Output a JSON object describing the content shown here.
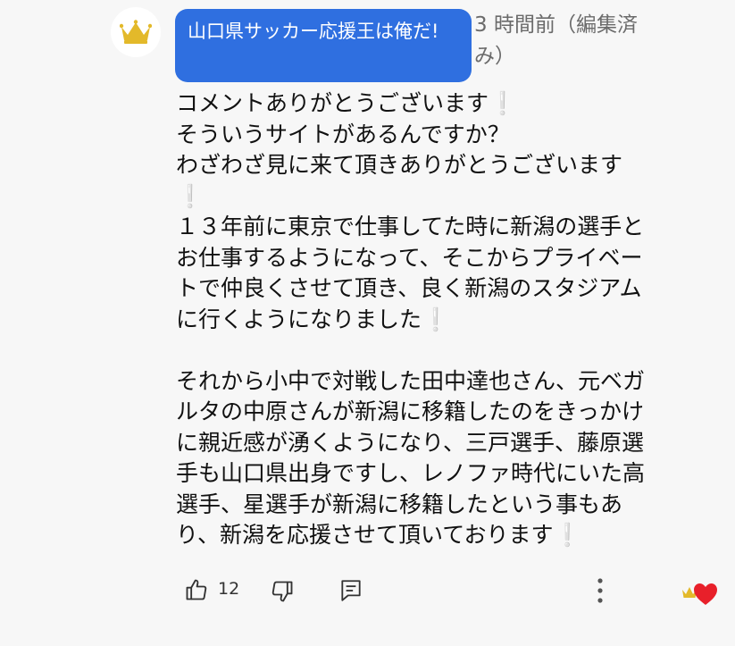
{
  "comment": {
    "author": "山口県サッカー応援王は俺だ!",
    "timestamp": "3 時間前（編集済み）",
    "avatar_icon": "crown-icon",
    "badge_color": "#2f6fe0",
    "body": {
      "p1": [
        "コメントありがとうございます",
        "そういうサイトがあるんですか？",
        "わざわざ見に来て頂きありがとうございます"
      ],
      "p2": [
        "１３年前に東京で仕事してた時に新潟の選手と",
        "お仕事するようになって、そこからプライベー",
        "トで仲良くさせて頂き、良く新潟のスタジアム",
        "に行くようになりました"
      ],
      "p3": [
        "それから小中で対戦した田中達也さん、元ベガ",
        "ルタの中原さんが新潟に移籍したのをきっかけ",
        "に親近感が湧くようになり、三戸選手、藤原選",
        "手も山口県出身ですし、レノファ時代にいた高",
        "選手、星選手が新潟に移籍したという事もあ",
        "り、新潟を応援させて頂いております"
      ]
    }
  },
  "actions": {
    "like_count": "12",
    "like_icon": "thumbs-up-icon",
    "dislike_icon": "thumbs-down-icon",
    "reply_icon": "reply-icon",
    "more_icon": "more-vertical-icon",
    "creator_heart_icon": "creator-heart-icon"
  },
  "colors": {
    "exclamation": "#d9d9d9",
    "heart": "#e8202a",
    "crown": "#e3b92a"
  }
}
